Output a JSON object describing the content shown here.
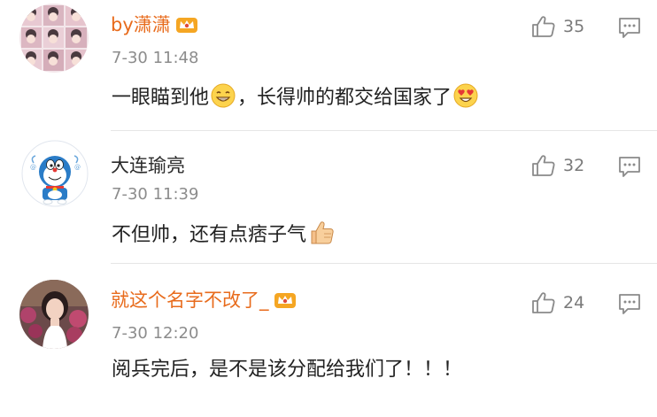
{
  "comments": [
    {
      "username": "by潇潇",
      "time": "7-30 11:48",
      "text_before_emoji": "一眼瞄到他",
      "text_after_emoji": "，长得帅的都交给国家了",
      "emojis": [
        "grin-emoji",
        "heart-eyes-emoji"
      ],
      "likes": "35",
      "vip": true
    },
    {
      "username": "大连瑜亮",
      "time": "7-30 11:39",
      "text": "不但帅，还有点痞子气",
      "emojis": [
        "thumbs-up-emoji"
      ],
      "likes": "32",
      "vip": false
    },
    {
      "username": "就这个名字不改了_",
      "time": "7-30 12:20",
      "text": "阅兵完后，是不是该分配给我们了！！！",
      "likes": "24",
      "vip": true
    }
  ],
  "colors": {
    "vip_name": "#e86b1c",
    "normal_name": "#2b2b2b",
    "meta": "#8c8c8c",
    "icon": "#8a8a8a",
    "divider": "#e6e6e6"
  }
}
